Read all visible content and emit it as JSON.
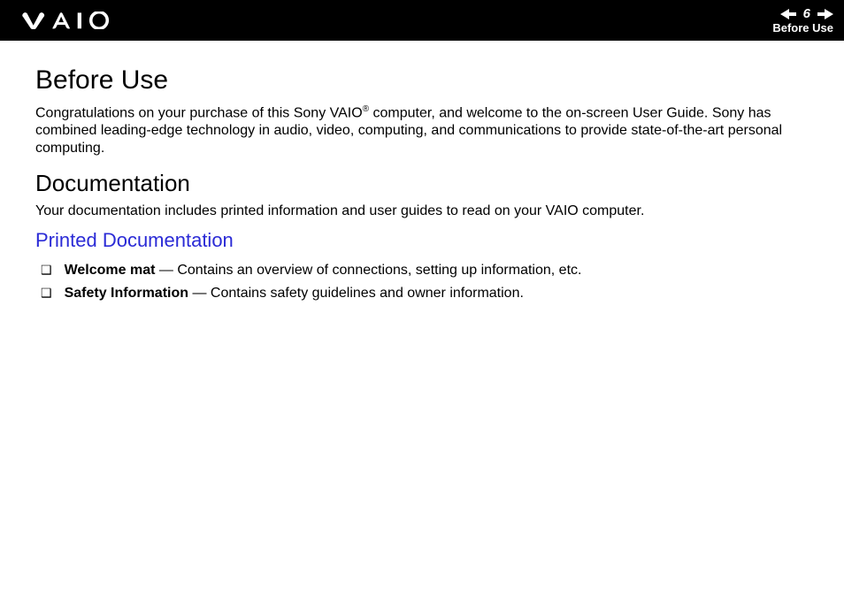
{
  "header": {
    "page_number": "6",
    "section_label": "Before Use"
  },
  "content": {
    "title": "Before Use",
    "intro_pre": "Congratulations on your purchase of this Sony VAIO",
    "intro_sup": "®",
    "intro_post": " computer, and welcome to the on-screen User Guide. Sony has combined leading-edge technology in audio, video, computing, and communications to provide state-of-the-art personal computing.",
    "h2": "Documentation",
    "doc_para": "Your documentation includes printed information and user guides to read on your VAIO computer.",
    "h3": "Printed Documentation",
    "items": [
      {
        "title": "Welcome mat",
        "desc": " — Contains an overview of connections, setting up information, etc."
      },
      {
        "title": "Safety Information",
        "desc": " — Contains safety guidelines and owner information."
      }
    ]
  }
}
